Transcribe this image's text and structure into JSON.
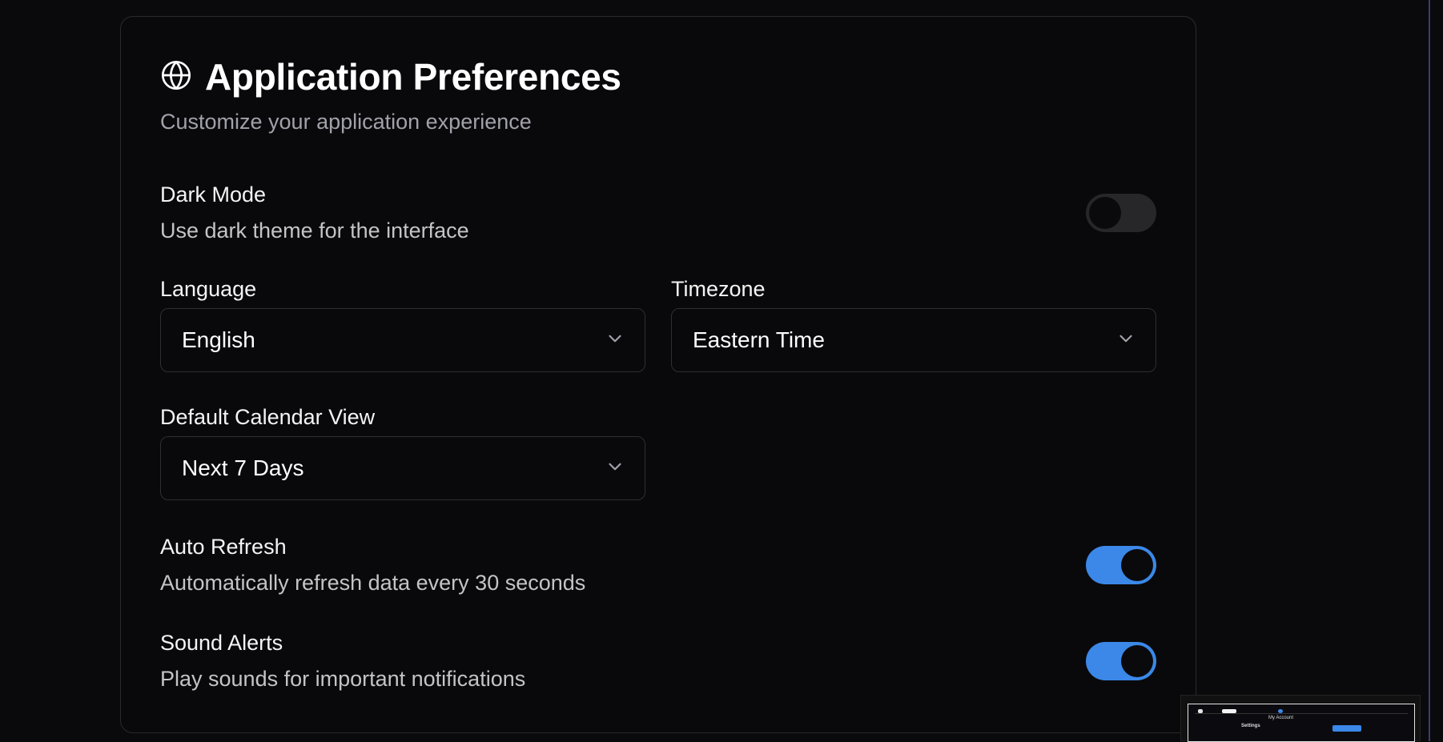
{
  "header": {
    "title": "Application Preferences",
    "subtitle": "Customize your application experience",
    "icon": "globe-icon"
  },
  "settings": {
    "dark_mode": {
      "label": "Dark Mode",
      "description": "Use dark theme for the interface",
      "enabled": false
    },
    "auto_refresh": {
      "label": "Auto Refresh",
      "description": "Automatically refresh data every 30 seconds",
      "enabled": true
    },
    "sound_alerts": {
      "label": "Sound Alerts",
      "description": "Play sounds for important notifications",
      "enabled": true
    }
  },
  "fields": {
    "language": {
      "label": "Language",
      "value": "English"
    },
    "timezone": {
      "label": "Timezone",
      "value": "Eastern Time"
    },
    "calendar_view": {
      "label": "Default Calendar View",
      "value": "Next 7 Days"
    }
  },
  "thumbnail": {
    "title": "Settings",
    "menu_label": "My Account"
  },
  "colors": {
    "accent": "#3b88e8",
    "background": "#0a0a0c",
    "border": "#2a2a2e",
    "muted_text": "#a1a1aa"
  }
}
